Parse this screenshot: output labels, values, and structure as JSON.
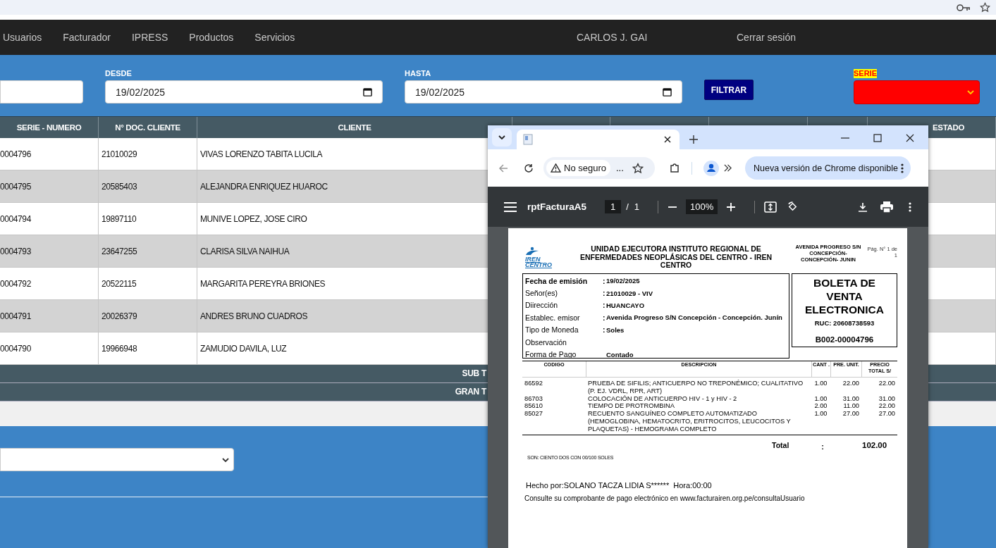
{
  "nav": {
    "items": [
      "Usuarios",
      "Facturador",
      "IPRESS",
      "Productos",
      "Servicios"
    ],
    "user": "CARLOS J. GAI",
    "logout": "Cerrar sesión"
  },
  "filters": {
    "desde_label": "DESDE",
    "desde": "19/02/2025",
    "hasta_label": "HASTA",
    "hasta": "19/02/2025",
    "filter_button": "FILTRAR",
    "serie_label": "SERIE"
  },
  "table": {
    "columns": [
      "SERIE - NUMERO",
      "N° DOC. CLIENTE",
      "CLIENTE",
      "ESTADO"
    ],
    "rows": [
      {
        "serie": "0004796",
        "doc": "21010029",
        "cliente": "VIVAS LORENZO TABITA LUCILA"
      },
      {
        "serie": "0004795",
        "doc": "20585403",
        "cliente": "ALEJANDRA ENRIQUEZ HUAROC"
      },
      {
        "serie": "0004794",
        "doc": "19897110",
        "cliente": "MUNIVE LOPEZ, JOSE CIRO"
      },
      {
        "serie": "0004793",
        "doc": "23647255",
        "cliente": "CLARISA SILVA NAIHUA"
      },
      {
        "serie": "0004792",
        "doc": "20522115",
        "cliente": "MARGARITA PEREYRA BRIONES"
      },
      {
        "serie": "0004791",
        "doc": "20026379",
        "cliente": "ANDRES BRUNO CUADROS"
      },
      {
        "serie": "0004790",
        "doc": "19966948",
        "cliente": "ZAMUDIO DAVILA, LUZ"
      }
    ],
    "totals": [
      "SUB T",
      "GRAN T"
    ]
  },
  "popup": {
    "security": "No seguro",
    "address": "...",
    "update_button": "Nueva versión de Chrome disponible",
    "pdf": {
      "title": "rptFacturaA5",
      "page": "1",
      "page_sep": "/",
      "page_count": "1",
      "zoom": "100%"
    },
    "receipt": {
      "logo": [
        "IREN",
        "CENTRO"
      ],
      "org": "UNIDAD EJECUTORA INSTITUTO REGIONAL DE ENFERMEDADES NEOPLÁSICAS DEL CENTRO - IREN CENTRO",
      "address": "AVENIDA PROGRESO S/N CONCEPCIÓN- CONCEPCIÓN- JUNIN",
      "page": "Pág. N° 1 de 1",
      "fields": [
        {
          "label": "Fecha de emisión",
          "colon": ":",
          "value": "19/02/2025",
          "bold_label": true
        },
        {
          "label": "Señor(es)",
          "colon": ":",
          "value": "21010029 - VIV",
          "bold_label": false
        },
        {
          "label": "Diirección",
          "colon": ":",
          "value": " HUANCAYO",
          "bold_label": false
        },
        {
          "label": "Establec. emisor",
          "colon": ":",
          "value": "Avenida Progreso S/N Concepción - Concepción. Junín",
          "bold_label": false
        },
        {
          "label": "Tipo de Moneda",
          "colon": ":",
          "value": "Soles",
          "bold_label": false
        },
        {
          "label": "Observación",
          "bold_label": false
        },
        {
          "label": "Forma de Pago",
          "value": "Contado",
          "bold_label": false
        }
      ],
      "doc_title": "BOLETA DE VENTA ELECTRONICA",
      "ruc": "RUC: 20608738593",
      "number": "B002-00004796",
      "columns": [
        "CODIGO",
        "DESCRIPCION",
        "CANT .",
        "PRE. UNIT.",
        "PRECIO TOTAL S/"
      ],
      "items": [
        {
          "code": "86592",
          "desc": "PRUEBA DE SIFILIS; ANTICUERPO NO TREPONÉMICO; CUALITATIVO (P. EJ. VDRL, RPR, ART)",
          "qty": "1.00",
          "unit": "22.00",
          "total": "22.00"
        },
        {
          "code": "86703",
          "desc": "COLOCACIÓN DE ANTICUERPO HIV - 1 y HIV - 2",
          "qty": "1.00",
          "unit": "31.00",
          "total": "31.00"
        },
        {
          "code": "85610",
          "desc": "TIEMPO DE PROTROMBINA",
          "qty": "2.00",
          "unit": "11.00",
          "total": "22.00"
        },
        {
          "code": "85027",
          "desc": "RECUENTO SANGUÍNEO COMPLETO AUTOMATIZADO (HEMOGLOBINA, HEMATOCRITO, ERITROCITOS, LEUCOCITOS Y PLAQUETAS) - HEMOGRAMA COMPLETO",
          "qty": "1.00",
          "unit": "27.00",
          "total": "27.00"
        }
      ],
      "total_label": "Total",
      "total_colon": ":",
      "total": "102.00",
      "words": "SON: CIENTO DOS CON 00/100 SOLES",
      "made_by": "Hecho por:SOLANO TACZA LIDIA S******  Hora:00:00",
      "consult": "Consulte su comprobante de pago electrónico en www.facturairen.org.pe/consultaUsuario"
    }
  }
}
